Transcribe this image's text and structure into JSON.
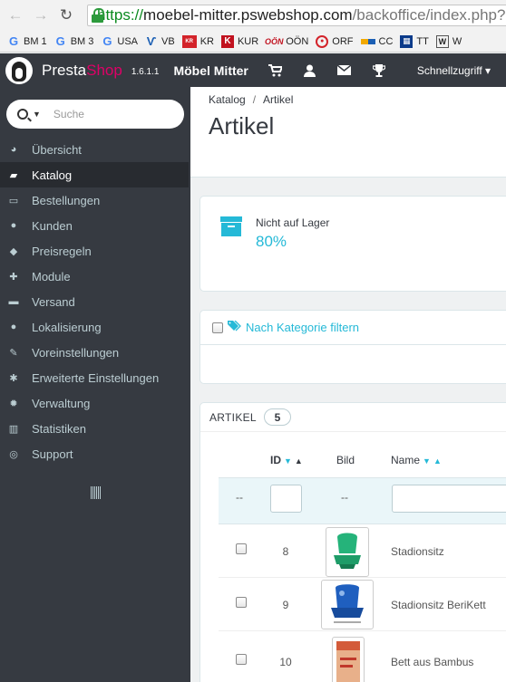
{
  "browser": {
    "url_scheme": "https://",
    "url_host": "moebel-mitter.pswebshop.com",
    "url_path": "/backoffice/index.php?c",
    "bookmarks": [
      {
        "label": "BM 1",
        "icon": "google-icon"
      },
      {
        "label": "BM 3",
        "icon": "google-icon"
      },
      {
        "label": "USA",
        "icon": "google-icon"
      },
      {
        "label": "VB",
        "icon": "vb-icon"
      },
      {
        "label": "KR",
        "icon": "kr-icon"
      },
      {
        "label": "KUR",
        "icon": "k-icon"
      },
      {
        "label": "OÖN",
        "icon": "oon-icon"
      },
      {
        "label": "ORF",
        "icon": "orf-icon"
      },
      {
        "label": "CC",
        "icon": "cc-icon"
      },
      {
        "label": "TT",
        "icon": "tt-icon"
      },
      {
        "label": "W",
        "icon": "w-icon"
      }
    ]
  },
  "header": {
    "brand_presta": "Presta",
    "brand_shop": "Shop",
    "version": "1.6.1.1",
    "shop_name": "Möbel Mitter",
    "quick_access": "Schnellzugriff ▾"
  },
  "sidebar": {
    "search_placeholder": "Suche",
    "items": [
      {
        "label": "Übersicht",
        "icon": "dashboard-icon",
        "glyph": "◕"
      },
      {
        "label": "Katalog",
        "icon": "book-icon",
        "glyph": "▰"
      },
      {
        "label": "Bestellungen",
        "icon": "credit-card-icon",
        "glyph": "▭"
      },
      {
        "label": "Kunden",
        "icon": "users-icon",
        "glyph": "●"
      },
      {
        "label": "Preisregeln",
        "icon": "tags-icon",
        "glyph": "◆"
      },
      {
        "label": "Module",
        "icon": "puzzle-icon",
        "glyph": "✚"
      },
      {
        "label": "Versand",
        "icon": "truck-icon",
        "glyph": "▬"
      },
      {
        "label": "Lokalisierung",
        "icon": "globe-icon",
        "glyph": "●"
      },
      {
        "label": "Voreinstellungen",
        "icon": "wrench-icon",
        "glyph": "✎"
      },
      {
        "label": "Erweiterte Einstellungen",
        "icon": "cogs-icon",
        "glyph": "✱"
      },
      {
        "label": "Verwaltung",
        "icon": "gear-icon",
        "glyph": "✹"
      },
      {
        "label": "Statistiken",
        "icon": "bar-chart-icon",
        "glyph": "▥"
      },
      {
        "label": "Support",
        "icon": "lifebuoy-icon",
        "glyph": "◎"
      }
    ]
  },
  "page": {
    "breadcrumb_1": "Katalog",
    "breadcrumb_sep": "/",
    "breadcrumb_2": "Artikel",
    "title": "Artikel"
  },
  "kpi": {
    "label": "Nicht auf Lager",
    "value": "80%"
  },
  "filter": {
    "label": "Nach Kategorie filtern"
  },
  "list": {
    "title": "ARTIKEL",
    "count": "5",
    "col_id": "ID",
    "col_image": "Bild",
    "col_name": "Name",
    "filter_dash": "--",
    "rows": [
      {
        "id": "8",
        "name": "Stadionsitz"
      },
      {
        "id": "9",
        "name": "Stadionsitz BeriKett"
      },
      {
        "id": "10",
        "name": "Bett aus Bambus"
      }
    ]
  }
}
